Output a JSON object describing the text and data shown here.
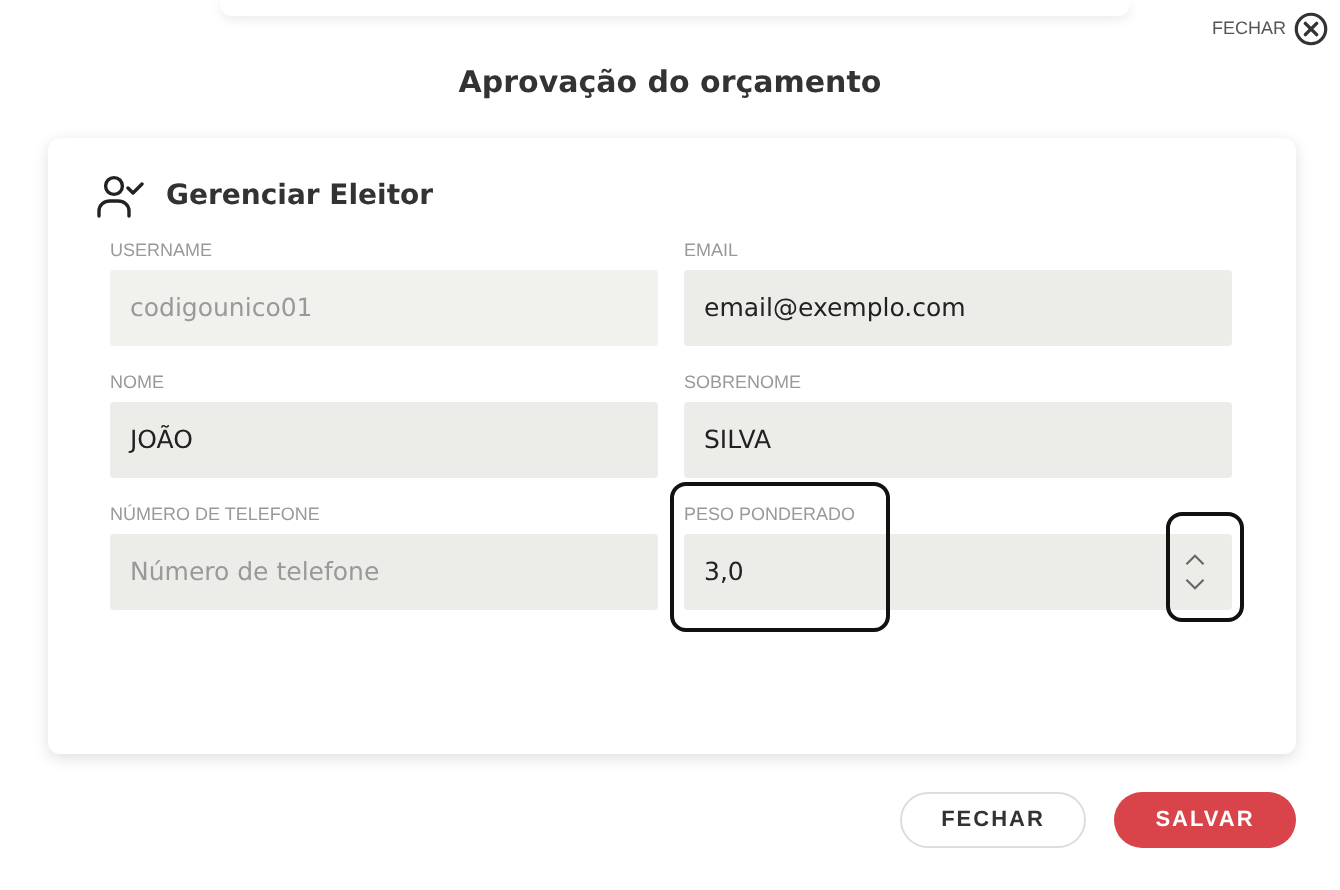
{
  "close_link": {
    "label": "FECHAR"
  },
  "title": "Aprovação do orçamento",
  "section": {
    "title": "Gerenciar Eleitor"
  },
  "fields": [
    {
      "kind": "text",
      "label": "USERNAME",
      "value": "codigounico01",
      "disabled": true
    },
    {
      "kind": "text",
      "label": "EMAIL",
      "value": "email@exemplo.com",
      "disabled": false
    },
    {
      "kind": "text",
      "label": "NOME",
      "value": "JOÃO",
      "disabled": false
    },
    {
      "kind": "text",
      "label": "SOBRENOME",
      "value": "SILVA",
      "disabled": false
    },
    {
      "kind": "text",
      "label": "NÚMERO DE TELEFONE",
      "placeholder": "Número de telefone",
      "disabled": false
    },
    {
      "kind": "number",
      "label": "PESO PONDERADO",
      "value": "3,0",
      "disabled": false,
      "highlighted": true,
      "stepper_highlighted": true
    }
  ],
  "buttons": [
    {
      "label": "FECHAR",
      "kind": "secondary"
    },
    {
      "label": "SALVAR",
      "kind": "primary"
    }
  ]
}
